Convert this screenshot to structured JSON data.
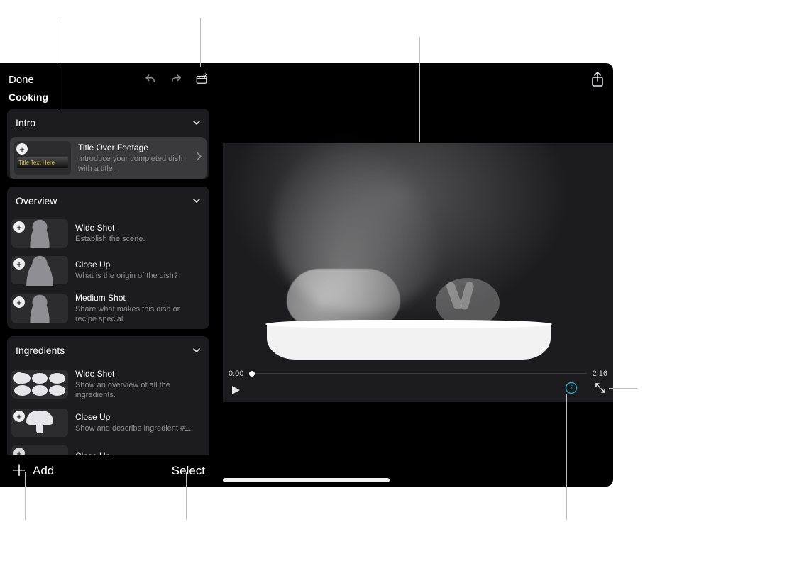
{
  "header": {
    "done_label": "Done",
    "project_name": "Cooking",
    "undo_icon": "undo-icon",
    "redo_icon": "redo-icon",
    "storyboard_icon": "storyboard-icon",
    "share_icon": "share-icon"
  },
  "sections": [
    {
      "title": "Intro",
      "clips": [
        {
          "title": "Title Over Footage",
          "desc": "Introduce your completed dish with a title.",
          "selected": true,
          "thumb_kind": "title"
        }
      ]
    },
    {
      "title": "Overview",
      "clips": [
        {
          "title": "Wide Shot",
          "desc": "Establish the scene.",
          "thumb_kind": "sil-wide"
        },
        {
          "title": "Close Up",
          "desc": "What is the origin of the dish?",
          "thumb_kind": "sil-close"
        },
        {
          "title": "Medium Shot",
          "desc": "Share what makes this dish or recipe special.",
          "thumb_kind": "sil-wide"
        }
      ]
    },
    {
      "title": "Ingredients",
      "clips": [
        {
          "title": "Wide Shot",
          "desc": "Show an overview of all the ingredients.",
          "thumb_kind": "ing-grid"
        },
        {
          "title": "Close Up",
          "desc": "Show and describe ingredient #1.",
          "thumb_kind": "mushroom"
        },
        {
          "title": "Close Up",
          "desc": "",
          "thumb_kind": "partial"
        }
      ]
    }
  ],
  "thumb_overlay_text": "Title Text Here",
  "footer": {
    "add_label": "Add",
    "select_label": "Select"
  },
  "player": {
    "time_current": "0:00",
    "time_total": "2:16",
    "accent_color": "#2aa7c7"
  }
}
